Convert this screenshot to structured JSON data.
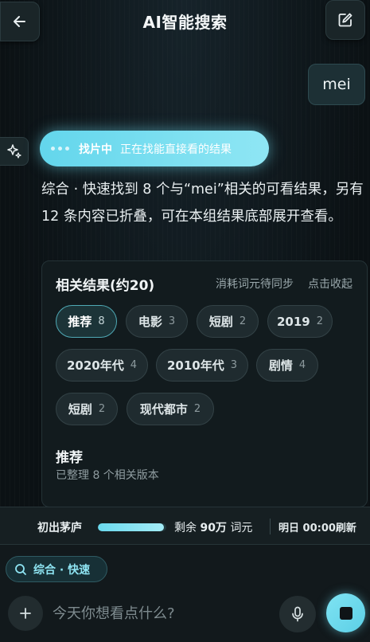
{
  "header": {
    "title": "AI智能搜索"
  },
  "conversation": {
    "user_message": "mei",
    "status": {
      "main": "找片中",
      "sub": "正在找能直接看的结果"
    },
    "summary": "综合 · 快速找到 8 个与“mei”相关的可看结果，另有 12 条内容已折叠，可在本组结果底部展开查看。"
  },
  "results_card": {
    "title": "相关结果(约20)",
    "sync_note": "消耗词元待同步",
    "collapse_label": "点击收起",
    "chips": [
      {
        "label": "推荐",
        "count": "8",
        "active": true
      },
      {
        "label": "电影",
        "count": "3"
      },
      {
        "label": "短剧",
        "count": "2"
      },
      {
        "label": "2019",
        "count": "2"
      },
      {
        "label": "2020年代",
        "count": "4"
      },
      {
        "label": "2010年代",
        "count": "3"
      },
      {
        "label": "剧情",
        "count": "4"
      },
      {
        "label": "短剧",
        "count": "2"
      },
      {
        "label": "现代都市",
        "count": "2"
      }
    ],
    "section_title": "推荐",
    "section_sub": "已整理 8 个相关版本"
  },
  "quota": {
    "name": "初出茅庐",
    "progress_fraction": 0.97,
    "remain_prefix": "剩余",
    "remain_amount": "90万",
    "remain_unit": "词元",
    "reset_note": "明日 00:00刷新"
  },
  "input_bar": {
    "mode_label": "综合 · 快速",
    "placeholder": "今天你想看点什么?"
  },
  "colors": {
    "accent": "#6ad9ee",
    "background": "#0b1114"
  }
}
